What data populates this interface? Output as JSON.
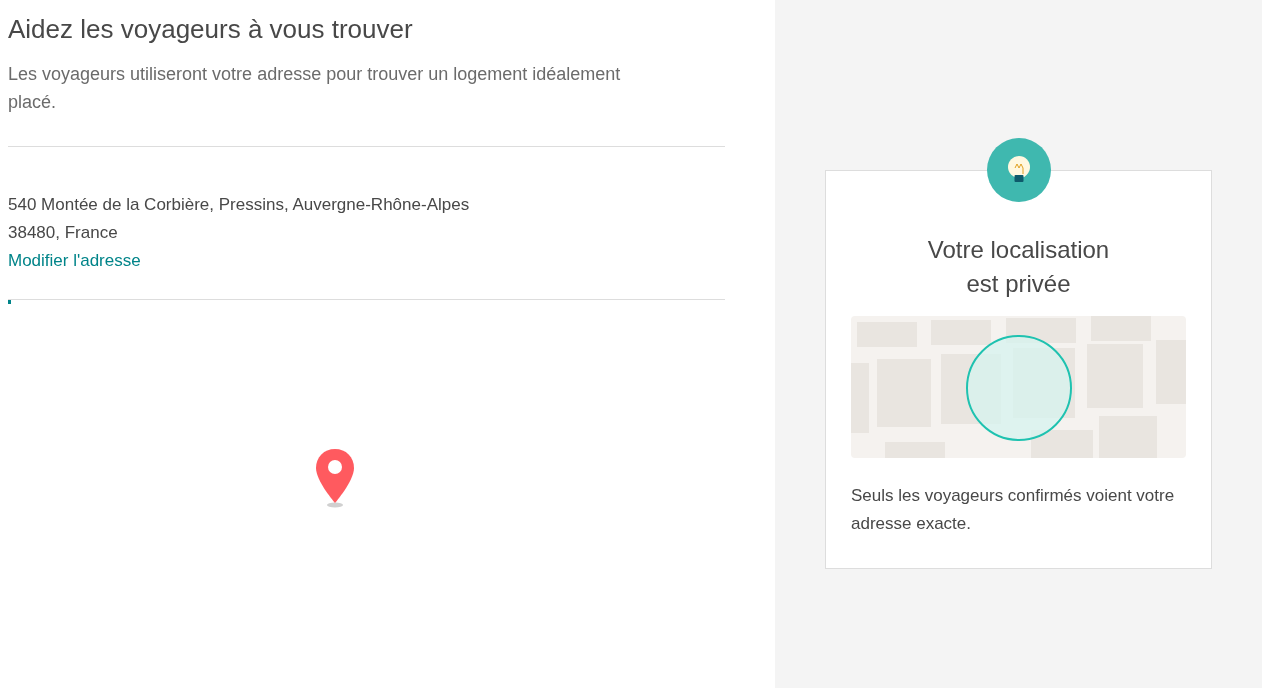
{
  "heading": "Aidez les voyageurs à vous trouver",
  "intro": "Les voyageurs utiliseront votre adresse pour trouver un logement idéalement placé.",
  "address": {
    "line_1": "540 Montée de la Corbière, Pressins, Auvergne-Rhône-Alpes",
    "line_2": "38480, France",
    "edit_link": "Modifier l'adresse"
  },
  "map_loading": {
    "level": 0.004
  },
  "privacy_card": {
    "title_line_1": "Votre localisation",
    "title_line_2": "est privée",
    "text": "Seuls les voyageurs confirmés voient votre adresse exacte."
  }
}
